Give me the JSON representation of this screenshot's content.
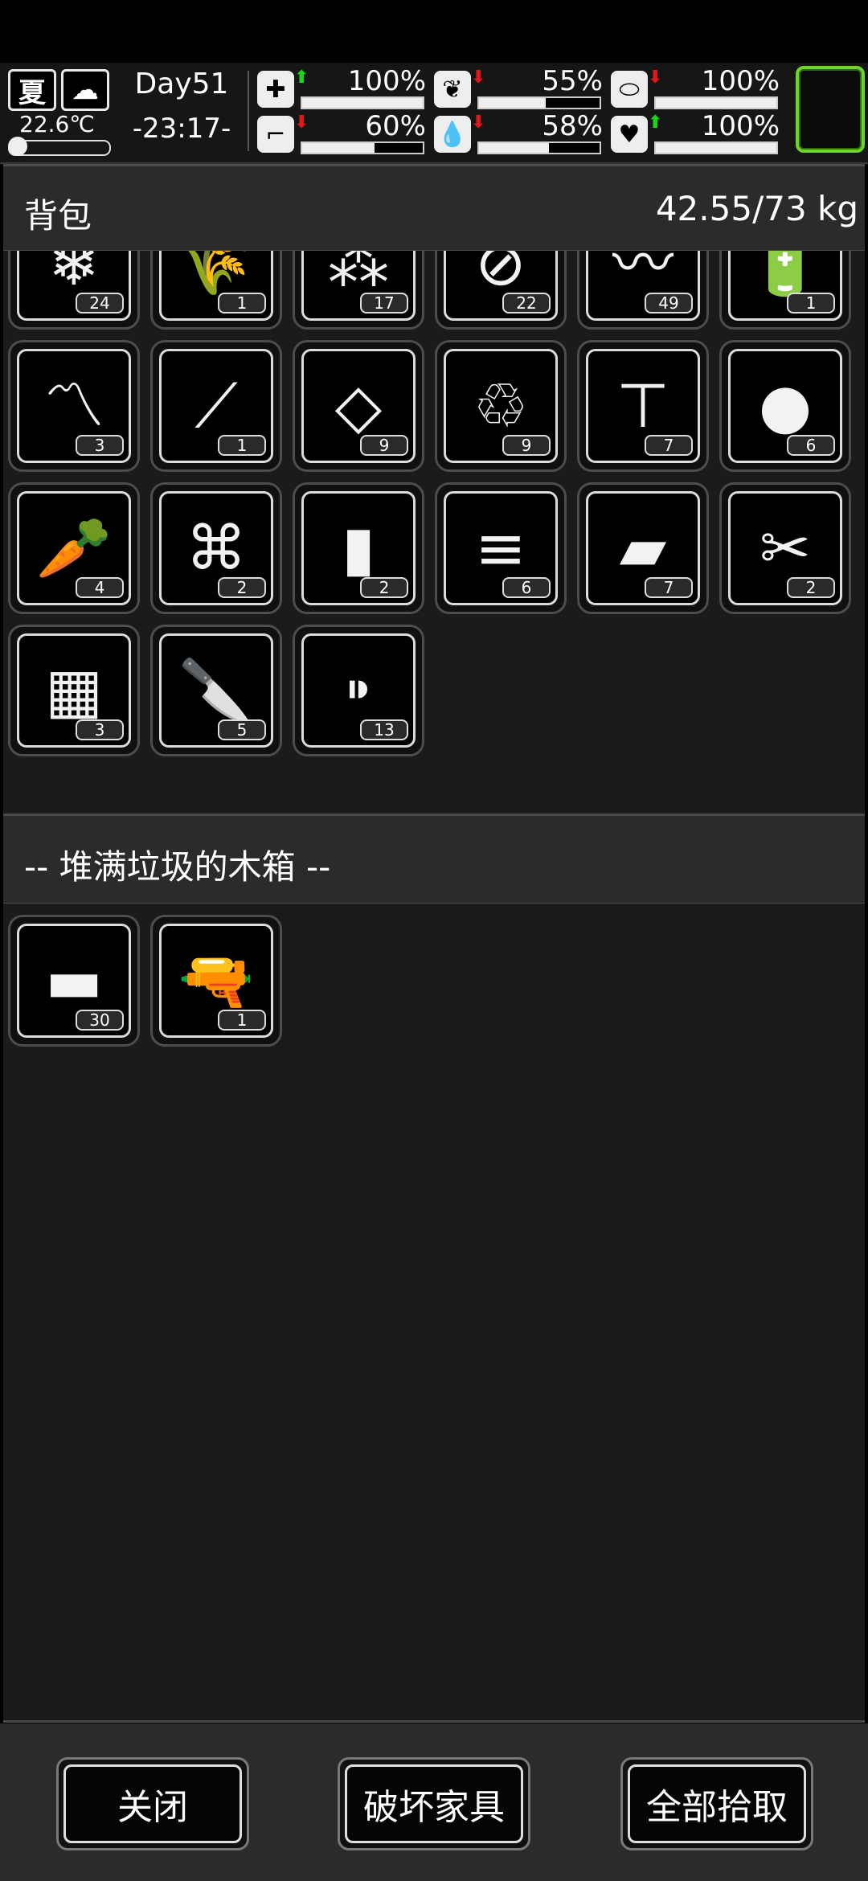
{
  "status_bar": {
    "season": "夏",
    "weather_icon": "cloud-moon-icon",
    "temperature": "22.6℃",
    "day": "Day51",
    "time": "-23:17-",
    "stats": [
      {
        "name": "health",
        "icon": "medkit-icon",
        "trend": "up",
        "value_text": "100%",
        "value": 100
      },
      {
        "name": "hunger",
        "icon": "stomach-icon",
        "trend": "down",
        "value_text": "55%",
        "value": 55
      },
      {
        "name": "vitamin",
        "icon": "pill-icon",
        "trend": "down",
        "value_text": "100%",
        "value": 100
      },
      {
        "name": "stamina",
        "icon": "boot-icon",
        "trend": "down",
        "value_text": "60%",
        "value": 60
      },
      {
        "name": "thirst",
        "icon": "water-drop-icon",
        "trend": "down",
        "value_text": "58%",
        "value": 58
      },
      {
        "name": "mood",
        "icon": "heart-icon",
        "trend": "up",
        "value_text": "100%",
        "value": 100
      }
    ],
    "accent_color": "#6ed42a"
  },
  "backpack": {
    "title": "背包",
    "weight": "42.55/73 kg",
    "items": [
      {
        "icon": "ice-icon",
        "glyph": "❄",
        "count": "24"
      },
      {
        "icon": "wheat-icon",
        "glyph": "🌾",
        "count": "1"
      },
      {
        "icon": "rubble-icon",
        "glyph": "⁂",
        "count": "17"
      },
      {
        "icon": "bottle-icon",
        "glyph": "⊘",
        "count": "22"
      },
      {
        "icon": "rag-icon",
        "glyph": "〰",
        "count": "49"
      },
      {
        "icon": "battery-icon",
        "glyph": "🔋",
        "count": "1"
      },
      {
        "icon": "wire-icon",
        "glyph": "〽",
        "count": "3"
      },
      {
        "icon": "pipe-icon",
        "glyph": "⟋",
        "count": "1"
      },
      {
        "icon": "glass-shard-icon",
        "glyph": "◇",
        "count": "9"
      },
      {
        "icon": "plastic-bottle-icon",
        "glyph": "♲",
        "count": "9"
      },
      {
        "icon": "nail-icon",
        "glyph": "⊤",
        "count": "7"
      },
      {
        "icon": "meat-icon",
        "glyph": "●",
        "count": "6"
      },
      {
        "icon": "carrot-icon",
        "glyph": "🥕",
        "count": "4"
      },
      {
        "icon": "cloth-roll-icon",
        "glyph": "⌘",
        "count": "2"
      },
      {
        "icon": "water-bottle-icon",
        "glyph": "▮",
        "count": "2"
      },
      {
        "icon": "log-icon",
        "glyph": "≡",
        "count": "6"
      },
      {
        "icon": "plank-icon",
        "glyph": "▰",
        "count": "7"
      },
      {
        "icon": "paper-scrap-icon",
        "glyph": "✂",
        "count": "2"
      },
      {
        "icon": "brick-icon",
        "glyph": "▦",
        "count": "3"
      },
      {
        "icon": "knife-icon",
        "glyph": "🔪",
        "count": "5"
      },
      {
        "icon": "bullet-icon",
        "glyph": "⁍",
        "count": "13"
      }
    ]
  },
  "container": {
    "title": "-- 堆满垃圾的木箱 --",
    "items": [
      {
        "icon": "cement-bag-icon",
        "glyph": "▬",
        "count": "30"
      },
      {
        "icon": "pistol-icon",
        "glyph": "🔫",
        "count": "1"
      }
    ]
  },
  "buttons": {
    "close": "关闭",
    "destroy_furniture": "破坏家具",
    "take_all": "全部拾取"
  }
}
